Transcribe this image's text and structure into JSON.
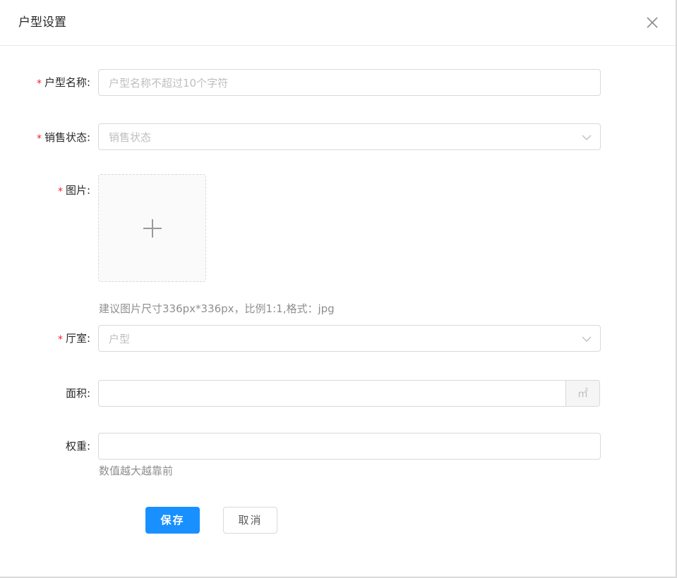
{
  "modal": {
    "title": "户型设置"
  },
  "form": {
    "name": {
      "label": "户型名称:",
      "required_mark": "*",
      "placeholder": "户型名称不超过10个字符"
    },
    "sale_status": {
      "label": "销售状态:",
      "required_mark": "*",
      "placeholder": "销售状态"
    },
    "image": {
      "label": "图片:",
      "required_mark": "*",
      "hint": "建议图片尺寸336px*336px，比例1:1,格式：jpg"
    },
    "room": {
      "label": "厅室:",
      "required_mark": "*",
      "placeholder": "户型"
    },
    "area": {
      "label": "面积:",
      "value": "",
      "unit": "㎡"
    },
    "weight": {
      "label": "权重:",
      "value": "",
      "hint": "数值越大越靠前"
    }
  },
  "actions": {
    "save_label": "保存",
    "cancel_label": "取消"
  },
  "icons": {
    "close": "close-icon",
    "chevron": "chevron-down-icon",
    "plus": "plus-icon"
  },
  "colors": {
    "primary": "#1890ff",
    "required": "#f5222d",
    "border": "#d9d9d9"
  }
}
